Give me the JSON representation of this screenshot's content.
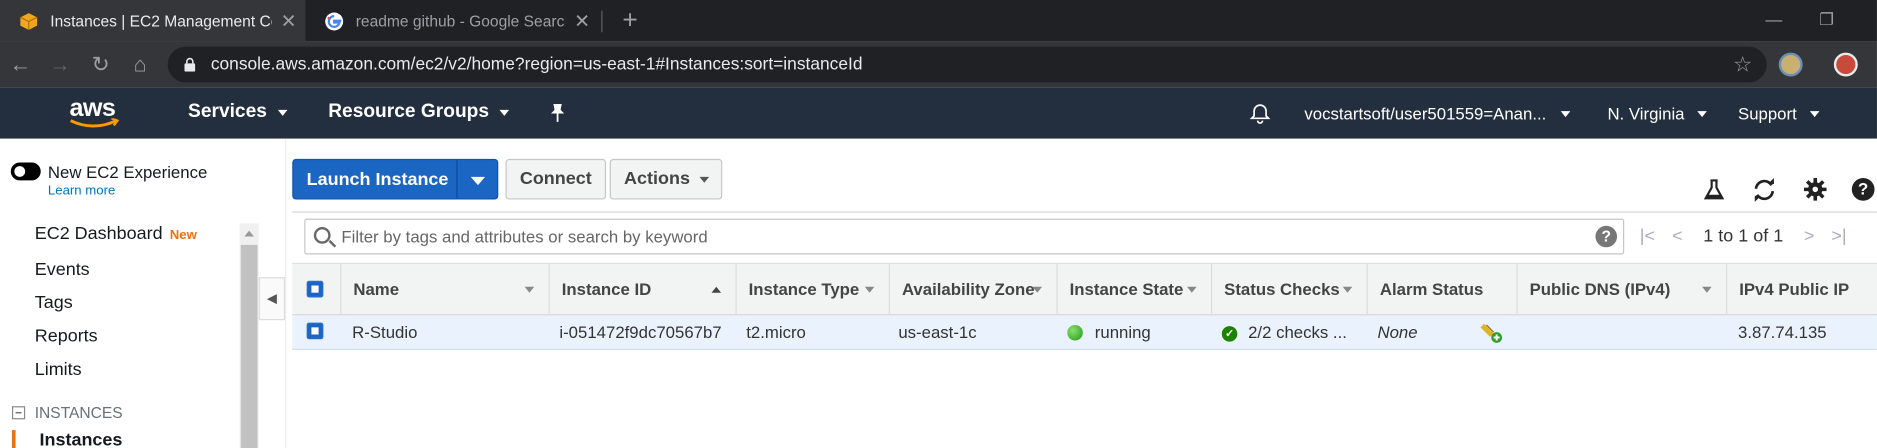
{
  "browser": {
    "tabs": [
      {
        "title": "Instances | EC2 Management Con"
      },
      {
        "title": "readme github - Google Search"
      }
    ],
    "url": "console.aws.amazon.com/ec2/v2/home?region=us-east-1#Instances:sort=instanceId"
  },
  "aws_header": {
    "logo_text": "aws",
    "services": "Services",
    "resource_groups": "Resource Groups",
    "account": "vocstartsoft/user501559=Anan...",
    "region": "N. Virginia",
    "support": "Support"
  },
  "sidebar": {
    "new_experience": "New EC2 Experience",
    "learn_more": "Learn more",
    "items": [
      {
        "label": "EC2 Dashboard",
        "badge": "New"
      },
      {
        "label": "Events"
      },
      {
        "label": "Tags"
      },
      {
        "label": "Reports"
      },
      {
        "label": "Limits"
      }
    ],
    "section": "INSTANCES",
    "active_item": "Instances"
  },
  "toolbar": {
    "launch": "Launch Instance",
    "connect": "Connect",
    "actions": "Actions"
  },
  "filter": {
    "placeholder": "Filter by tags and attributes or search by keyword",
    "help": "?"
  },
  "pagination": {
    "text": "1 to 1 of 1"
  },
  "table": {
    "columns": [
      "Name",
      "Instance ID",
      "Instance Type",
      "Availability Zone",
      "Instance State",
      "Status Checks",
      "Alarm Status",
      "Public DNS (IPv4)",
      "IPv4 Public IP"
    ],
    "rows": [
      {
        "name": "R-Studio",
        "instance_id": "i-051472f9dc70567b7",
        "type": "t2.micro",
        "zone": "us-east-1c",
        "state": "running",
        "status": "2/2 checks ...",
        "alarm": "None",
        "public_dns": "",
        "public_ip": "3.87.74.135"
      }
    ]
  },
  "colors": {
    "aws_nav": "#232f3e",
    "primary_button": "#1a66c2",
    "accent": "#ec7211",
    "running": "#1e9a12"
  }
}
